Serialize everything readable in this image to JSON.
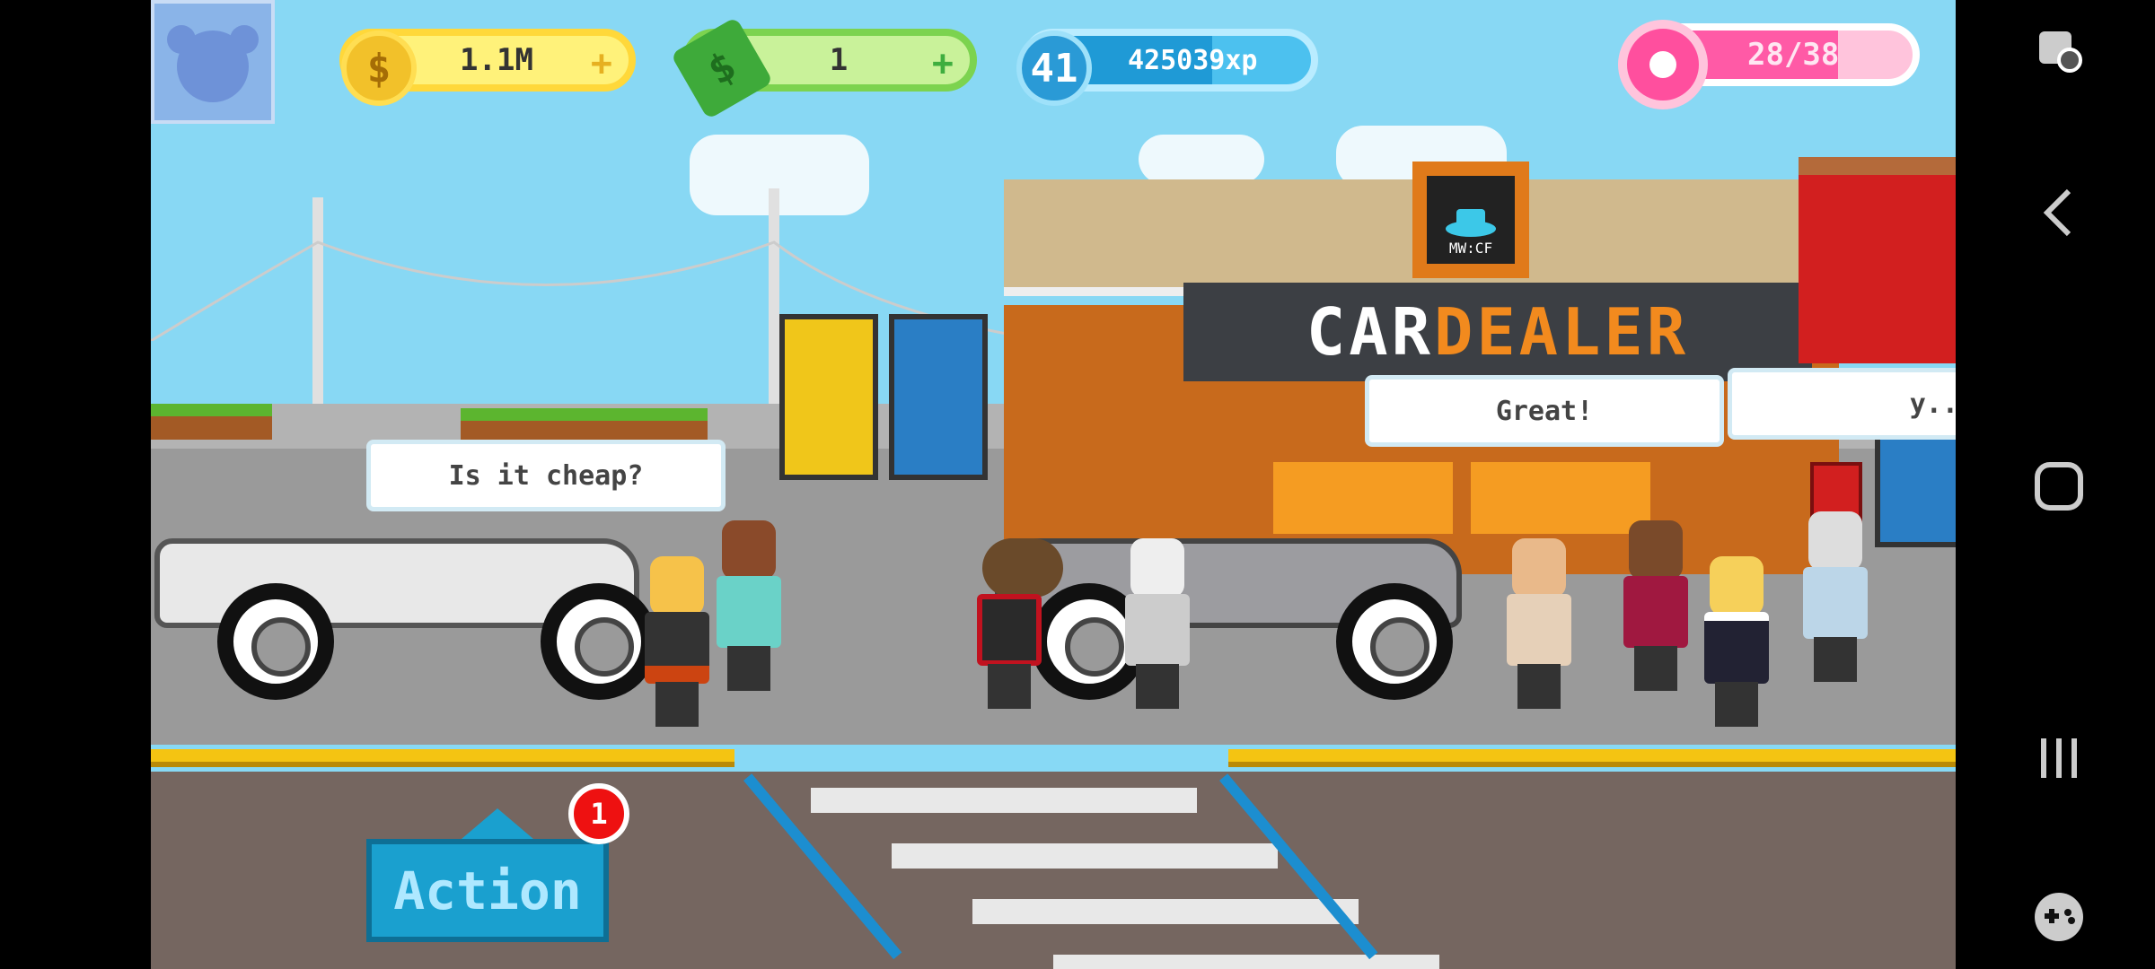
{
  "hud": {
    "coins": "1.1M",
    "cash": "1",
    "level": "41",
    "xp": "425039xp",
    "donut_count": "28/38",
    "donut_progress": 0.737,
    "xp_progress": 0.65
  },
  "scene": {
    "dealer_sign_left": "CAR ",
    "dealer_sign_right": "DEALER",
    "dealer_logo_text": "MW:CF"
  },
  "bubbles": {
    "left": "Is it cheap?",
    "center": "Great!",
    "right": "y..."
  },
  "action": {
    "label": "Action",
    "badge": "1"
  },
  "colors": {
    "sky": "#88d8f4",
    "dealer_orange": "#e07a1a",
    "action_blue": "#1aa0cf",
    "curb_yellow": "#f4c412"
  }
}
